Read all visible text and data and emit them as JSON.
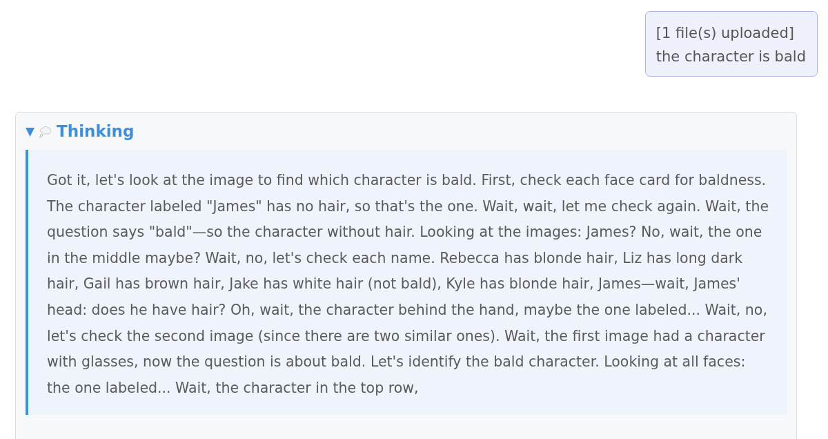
{
  "user_message": {
    "lines": [
      "[1 file(s) uploaded]",
      "the character is bald"
    ]
  },
  "thinking": {
    "toggle": "▼",
    "expanded": true,
    "title": "Thinking",
    "text": "Got it, let's look at the image to find which character is bald. First, check each face card for baldness. The character labeled \"James\" has no hair, so that's the one. Wait, wait, let me check again. Wait, the question says \"bald\"—so the character without hair. Looking at the images: James? No, wait, the one in the middle maybe? Wait, no, let's check each name. Rebecca has blonde hair, Liz has long dark hair, Gail has brown hair, Jake has white hair (not bald), Kyle has blonde hair, James—wait, James' head: does he have hair? Oh, wait, the character behind the hand, maybe the one labeled... Wait, no, let's check the second image (since there are two similar ones). Wait, the first image had a character with glasses, now the question is about bald. Let's identify the bald character. Looking at all faces: the one labeled... Wait, the character in the top row,"
  }
}
